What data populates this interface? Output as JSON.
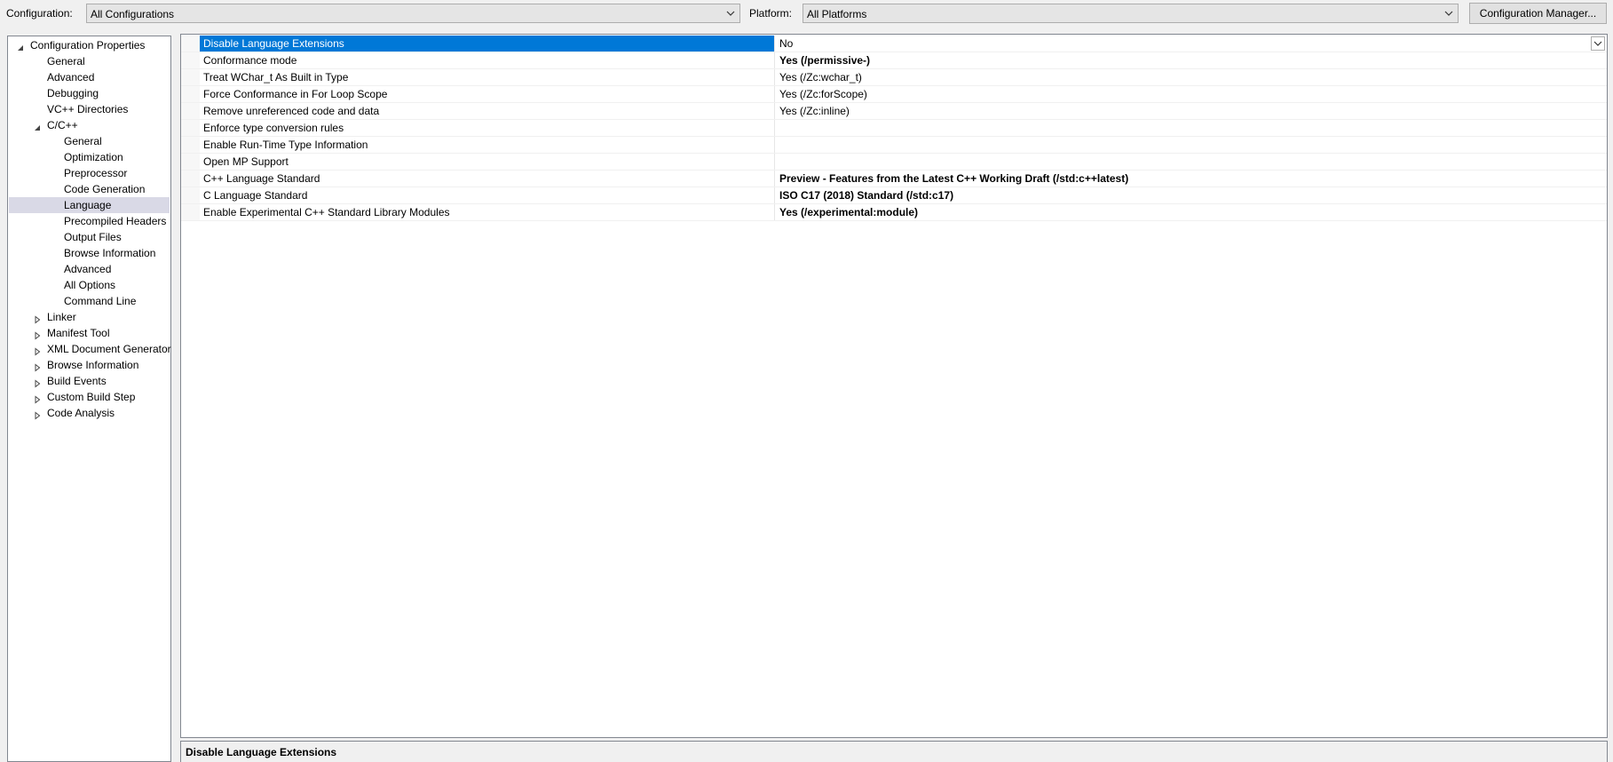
{
  "toolbar": {
    "configuration_label": "Configuration:",
    "configuration_value": "All Configurations",
    "platform_label": "Platform:",
    "platform_value": "All Platforms",
    "config_manager_label": "Configuration Manager..."
  },
  "icons": {
    "dropdown": "chevron-down-icon",
    "expanded": "triangle-expanded-icon",
    "collapsed": "triangle-collapsed-icon"
  },
  "tree": {
    "root": "Configuration Properties",
    "items": {
      "general": "General",
      "advanced": "Advanced",
      "debugging": "Debugging",
      "vcpp_directories": "VC++ Directories",
      "cpp": "C/C++",
      "cpp_general": "General",
      "cpp_optimization": "Optimization",
      "cpp_preprocessor": "Preprocessor",
      "cpp_code_generation": "Code Generation",
      "cpp_language": "Language",
      "cpp_precompiled_headers": "Precompiled Headers",
      "cpp_output_files": "Output Files",
      "cpp_browse_information": "Browse Information",
      "cpp_advanced": "Advanced",
      "cpp_all_options": "All Options",
      "cpp_command_line": "Command Line",
      "linker": "Linker",
      "manifest_tool": "Manifest Tool",
      "xml_document_generator": "XML Document Generator",
      "browse_information": "Browse Information",
      "build_events": "Build Events",
      "custom_build_step": "Custom Build Step",
      "code_analysis": "Code Analysis"
    }
  },
  "properties": [
    {
      "name": "Disable Language Extensions",
      "value": "No"
    },
    {
      "name": "Conformance mode",
      "value": "Yes (/permissive-)"
    },
    {
      "name": "Treat WChar_t As Built in Type",
      "value": "Yes (/Zc:wchar_t)"
    },
    {
      "name": "Force Conformance in For Loop Scope",
      "value": "Yes (/Zc:forScope)"
    },
    {
      "name": "Remove unreferenced code and data",
      "value": "Yes (/Zc:inline)"
    },
    {
      "name": "Enforce type conversion rules",
      "value": ""
    },
    {
      "name": "Enable Run-Time Type Information",
      "value": ""
    },
    {
      "name": "Open MP Support",
      "value": ""
    },
    {
      "name": "C++ Language Standard",
      "value": "Preview - Features from the Latest C++ Working Draft (/std:c++latest)"
    },
    {
      "name": "C Language Standard",
      "value": "ISO C17 (2018) Standard (/std:c17)"
    },
    {
      "name": "Enable Experimental C++ Standard Library Modules",
      "value": "Yes (/experimental:module)"
    }
  ],
  "description": {
    "title": "Disable Language Extensions"
  },
  "colors": {
    "selection": "#0078d7",
    "tree_selection": "#d9d9e6"
  }
}
